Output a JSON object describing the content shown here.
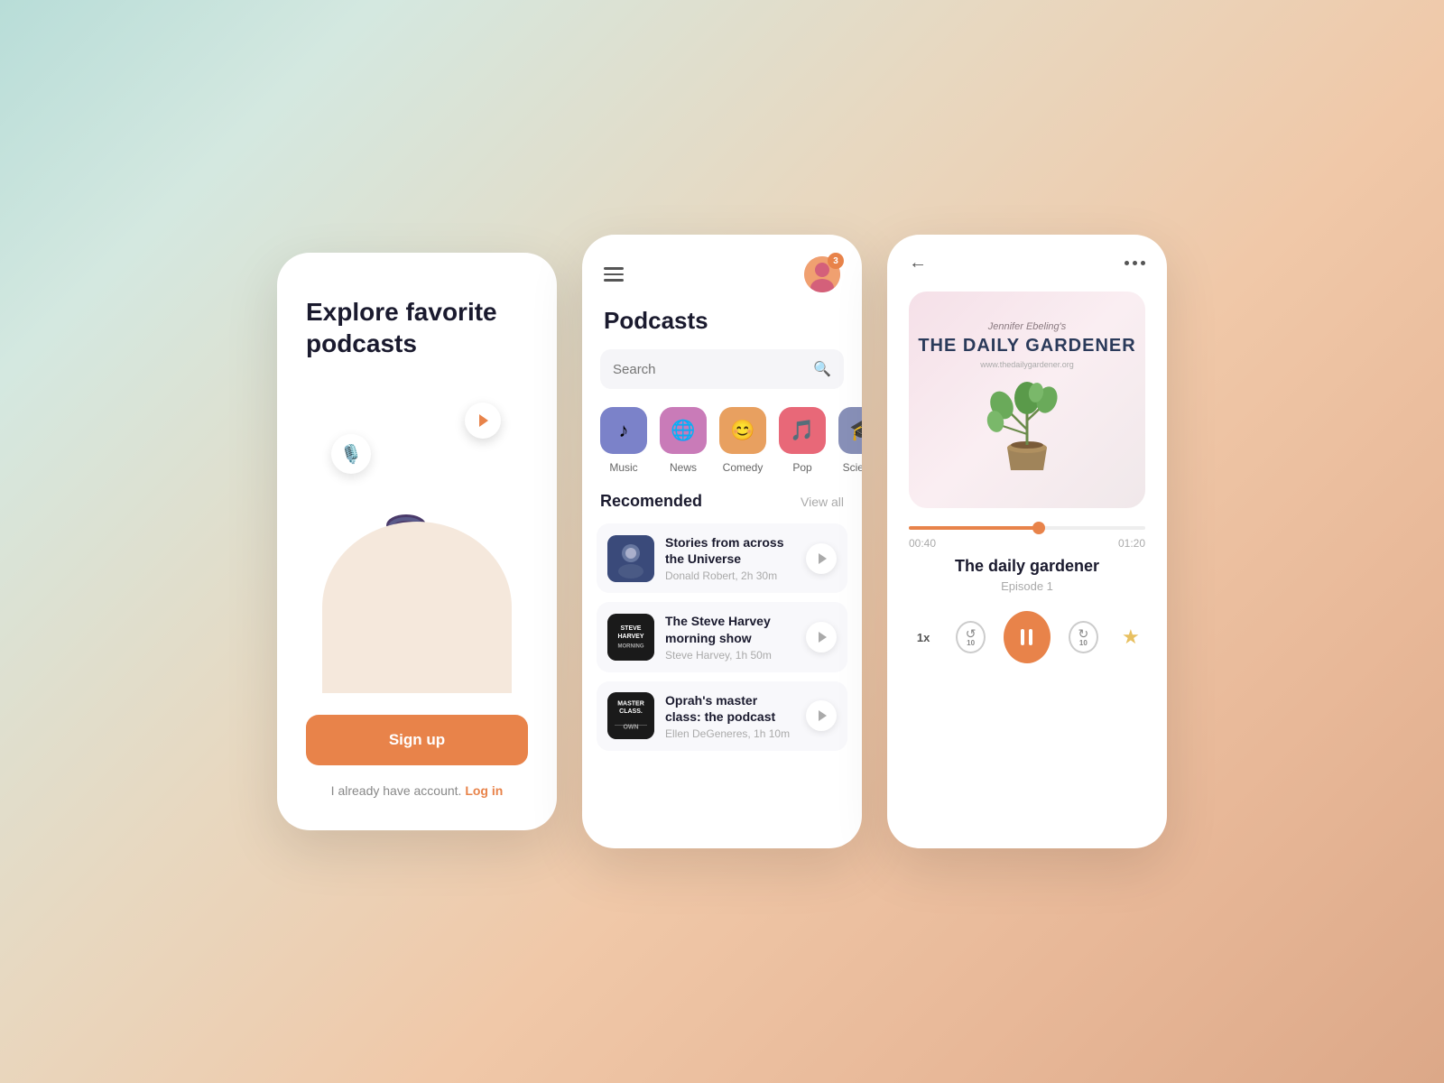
{
  "background": {
    "gradient": "linear-gradient(135deg, #b8ddd8 0%, #e8d0b8 50%, #e0a888 100%)"
  },
  "onboarding": {
    "title": "Explore favorite podcasts",
    "signup_label": "Sign up",
    "login_prompt": "I already have account.",
    "login_link": "Log in",
    "illustration_alt": "person listening to podcast on couch"
  },
  "podcasts": {
    "page_title": "Podcasts",
    "search_placeholder": "Search",
    "notification_count": "3",
    "categories": [
      {
        "id": "music",
        "label": "Music",
        "icon": "♪",
        "color": "#7b82c9"
      },
      {
        "id": "news",
        "label": "News",
        "icon": "🌐",
        "color": "#c97bb8"
      },
      {
        "id": "comedy",
        "label": "Comedy",
        "icon": "😊",
        "color": "#e8a060"
      },
      {
        "id": "pop",
        "label": "Pop",
        "icon": "🎵",
        "color": "#e86878"
      },
      {
        "id": "science",
        "label": "Science",
        "icon": "🎓",
        "color": "#8890b8"
      }
    ],
    "recommended_label": "Recomended",
    "view_all_label": "View all",
    "items": [
      {
        "id": "stories",
        "title": "Stories from across the Universe",
        "author": "Donald Robert",
        "duration": "2h 30m"
      },
      {
        "id": "steve-harvey",
        "title": "The Steve Harvey morning show",
        "author": "Steve Harvey",
        "duration": "1h 50m"
      },
      {
        "id": "oprah",
        "title": "Oprah's master class: the podcast",
        "author": "Ellen DeGeneres",
        "duration": "1h 10m"
      }
    ]
  },
  "player": {
    "album_subtitle": "Jennifer Ebeling's",
    "album_title": "THE DAILY GARDENER",
    "album_url": "www.thedailygardener.org",
    "progress_current": "00:40",
    "progress_total": "01:20",
    "progress_percent": 55,
    "track_title": "The daily gardener",
    "episode_label": "Episode 1",
    "speed_label": "1x",
    "skip_back_label": "10",
    "skip_forward_label": "10"
  }
}
